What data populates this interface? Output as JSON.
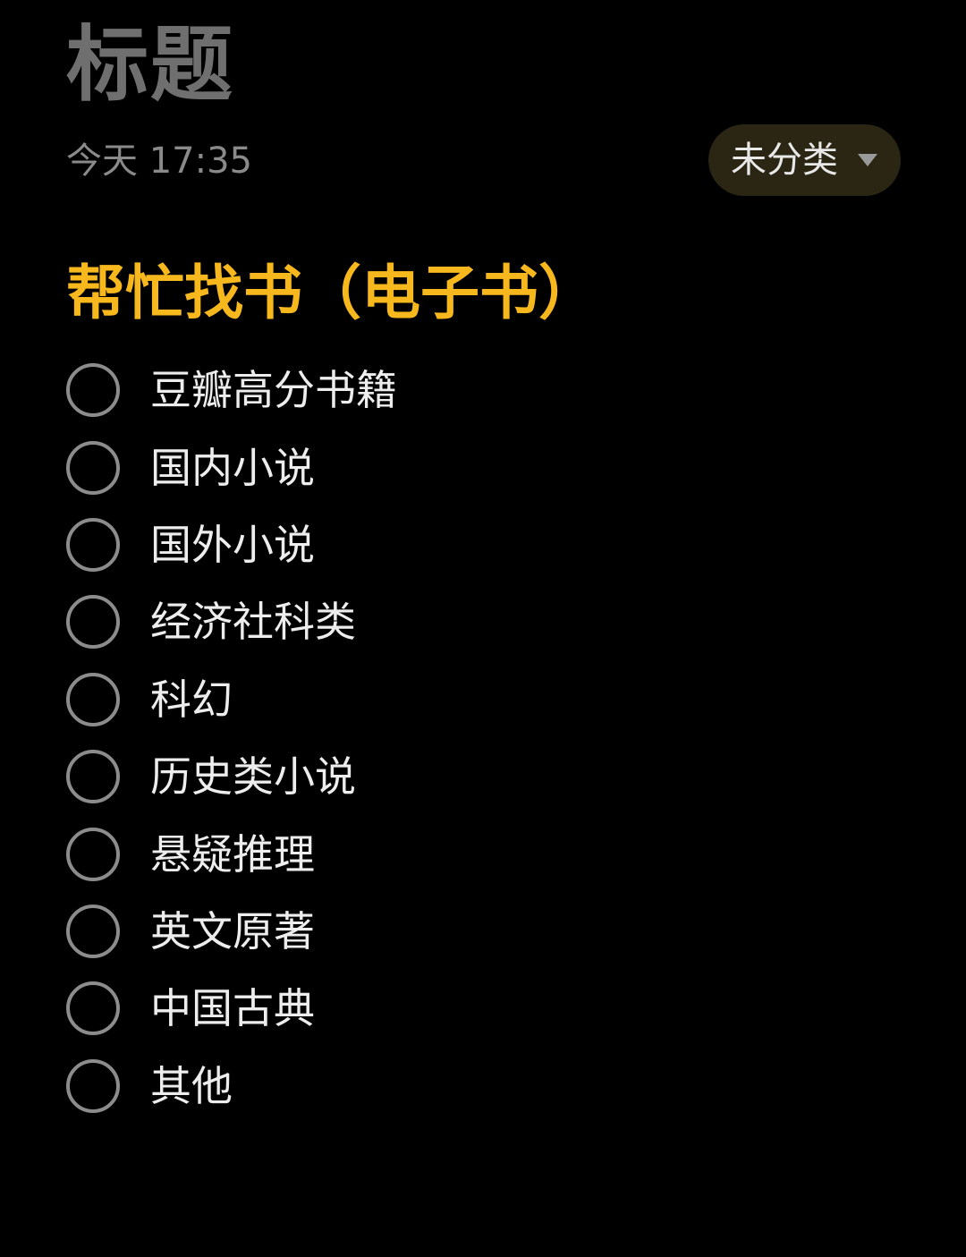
{
  "note": {
    "title": "标题",
    "date": "今天 17:35",
    "category": "未分类",
    "heading": "帮忙找书（电子书）",
    "checklist": [
      {
        "label": "豆瓣高分书籍",
        "checked": false
      },
      {
        "label": "国内小说",
        "checked": false
      },
      {
        "label": "国外小说",
        "checked": false
      },
      {
        "label": "经济社科类",
        "checked": false
      },
      {
        "label": "科幻",
        "checked": false
      },
      {
        "label": "历史类小说",
        "checked": false
      },
      {
        "label": "悬疑推理",
        "checked": false
      },
      {
        "label": "英文原著",
        "checked": false
      },
      {
        "label": "中国古典",
        "checked": false
      },
      {
        "label": "其他",
        "checked": false
      }
    ]
  },
  "colors": {
    "background": "#000000",
    "title": "#6f6f6f",
    "heading_accent": "#f7b81e",
    "category_pill": "#2b2614",
    "checkbox_border": "#8c8c8c",
    "item_text": "#ededed"
  },
  "icons": {
    "category_dropdown": "chevron-down-icon",
    "checkbox": "circle-outline-icon"
  }
}
